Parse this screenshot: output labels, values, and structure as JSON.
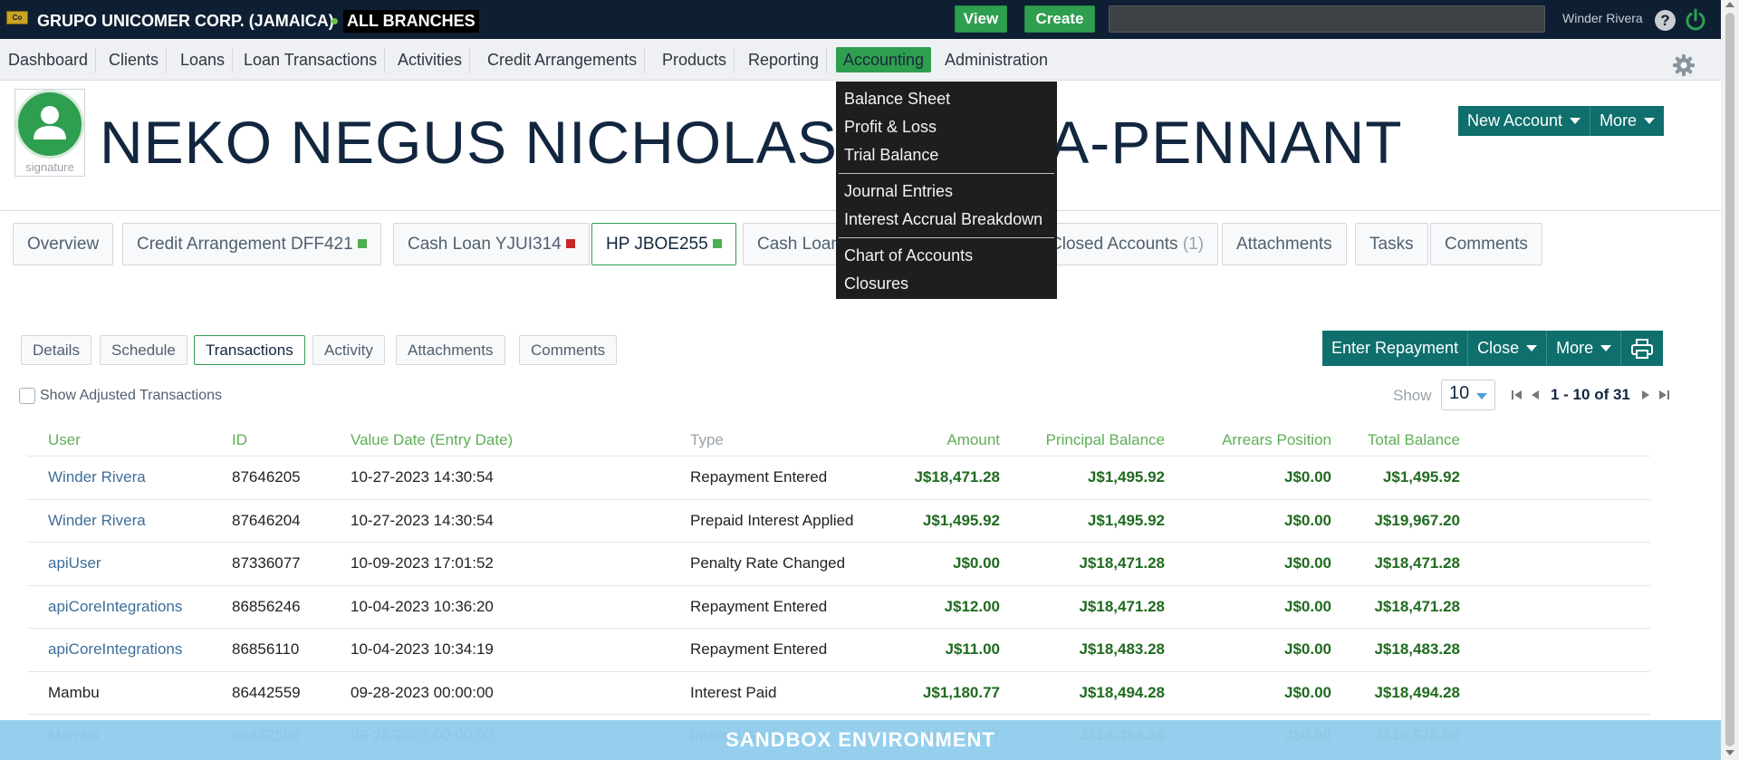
{
  "topbar": {
    "org_name": "GRUPO UNICOMER CORP. (JAMAICA)",
    "branch": "ALL BRANCHES",
    "view_label": "View",
    "create_label": "Create",
    "search_value": "",
    "user_name": "Winder Rivera",
    "help_glyph": "?"
  },
  "nav": {
    "items": [
      "Dashboard",
      "Clients",
      "Loans",
      "Loan Transactions",
      "Activities",
      "Credit Arrangements",
      "Products",
      "Reporting",
      "Accounting",
      "Administration"
    ],
    "active": "Accounting"
  },
  "accounting_menu": {
    "group1": [
      "Balance Sheet",
      "Profit & Loss",
      "Trial Balance"
    ],
    "group2": [
      "Journal Entries",
      "Interest Accrual Breakdown"
    ],
    "group3": [
      "Chart of Accounts",
      "Closures"
    ]
  },
  "client": {
    "name": "NEKO NEGUS NICHOLAS GARCIA-PENNANT",
    "signature_label": "signature",
    "new_account_label": "New Account",
    "more_label": "More"
  },
  "account_tabs": [
    {
      "label": "Overview"
    },
    {
      "label": "Credit Arrangement DFF421",
      "status_color": "#4caf50"
    },
    {
      "label": "Cash Loan YJUI314",
      "status_color": "#c62828"
    },
    {
      "label": "HP JBOE255",
      "status_color": "#4caf50"
    },
    {
      "label": "Cash Loan"
    },
    {
      "label": "Closed Accounts",
      "count": "(1)"
    },
    {
      "label": "Attachments"
    },
    {
      "label": "Tasks"
    },
    {
      "label": "Comments"
    }
  ],
  "sub_tabs": [
    "Details",
    "Schedule",
    "Transactions",
    "Activity",
    "Attachments",
    "Comments"
  ],
  "actions": {
    "enter_repayment": "Enter Repayment",
    "close": "Close",
    "more": "More"
  },
  "filters": {
    "show_adjusted": "Show Adjusted Transactions",
    "show_label": "Show",
    "page_size": "10",
    "range": "1 - 10 of 31"
  },
  "table": {
    "headers": {
      "user": "User",
      "id": "ID",
      "value_date": "Value Date (Entry Date)",
      "type": "Type",
      "amount": "Amount",
      "principal": "Principal Balance",
      "arrears": "Arrears Position",
      "total": "Total Balance"
    },
    "rows": [
      {
        "user": "Winder Rivera",
        "id": "87646205",
        "date": "10-27-2023 14:30:54",
        "type": "Repayment Entered",
        "amount": "J$18,471.28",
        "principal": "J$1,495.92",
        "arrears": "J$0.00",
        "total": "J$1,495.92"
      },
      {
        "user": "Winder Rivera",
        "id": "87646204",
        "date": "10-27-2023 14:30:54",
        "type": "Prepaid Interest Applied",
        "amount": "J$1,495.92",
        "principal": "J$1,495.92",
        "arrears": "J$0.00",
        "total": "J$19,967.20"
      },
      {
        "user": "apiUser",
        "id": "87336077",
        "date": "10-09-2023 17:01:52",
        "type": "Penalty Rate Changed",
        "amount": "J$0.00",
        "principal": "J$18,471.28",
        "arrears": "J$0.00",
        "total": "J$18,471.28"
      },
      {
        "user": "apiCoreIntegrations",
        "id": "86856246",
        "date": "10-04-2023 10:36:20",
        "type": "Repayment Entered",
        "amount": "J$12.00",
        "principal": "J$18,471.28",
        "arrears": "J$0.00",
        "total": "J$18,471.28"
      },
      {
        "user": "apiCoreIntegrations",
        "id": "86856110",
        "date": "10-04-2023 10:34:19",
        "type": "Repayment Entered",
        "amount": "J$11.00",
        "principal": "J$18,483.28",
        "arrears": "J$0.00",
        "total": "J$18,483.28"
      },
      {
        "user": "Mambu",
        "id": "86442559",
        "date": "09-28-2023 00:00:00",
        "type": "Interest Paid",
        "amount": "J$1,180.77",
        "principal": "J$18,494.28",
        "arrears": "J$0.00",
        "total": "J$18,494.28"
      },
      {
        "user": "Mambu",
        "id": "86442558",
        "date": "09-28-2023 00:00:00",
        "type": "Interest Applied",
        "amount": "J$1,180.77",
        "principal": "J$18,494.28",
        "arrears": "J$0.00",
        "total": "J$19,675.05"
      }
    ]
  },
  "banner": {
    "text": "SANDBOX ENVIRONMENT"
  },
  "colors": {
    "topbar": "#0f1f33",
    "accent_green": "#2e9e4f",
    "teal": "#0e6f6c",
    "money": "#1f6b1f",
    "link": "#3e6e9a"
  }
}
